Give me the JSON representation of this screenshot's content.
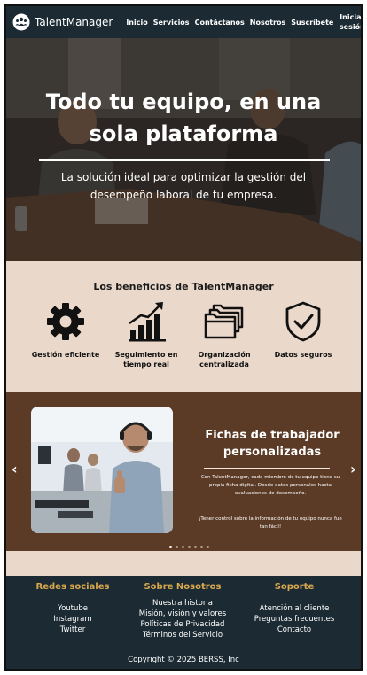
{
  "nav": {
    "brand": "TalentManager",
    "links": [
      "Inicio",
      "Servicios",
      "Contáctanos",
      "Nosotros",
      "Suscríbete"
    ],
    "login": "Iniciar sesión"
  },
  "hero": {
    "title": "Todo tu equipo, en una sola plataforma",
    "subtitle": "La solución ideal para optimizar la gestión del desempeño laboral de tu empresa."
  },
  "benefits": {
    "title": "Los beneficios de TalentManager",
    "items": [
      {
        "label": "Gestión eficiente",
        "icon": "gear-icon"
      },
      {
        "label": "Seguimiento en tiempo real",
        "icon": "growth-chart-icon"
      },
      {
        "label": "Organización centralizada",
        "icon": "folders-icon"
      },
      {
        "label": "Datos seguros",
        "icon": "shield-check-icon"
      }
    ]
  },
  "carousel": {
    "title": "Fichas de trabajador personalizadas",
    "text": "Con TalentManager, cada miembro de tu equipo tiene su propia ficha digital. Desde datos personales hasta evaluaciones de desempeño.",
    "text2": "¡Tener control sobre la información de tu equipo nunca fue tan fácil!",
    "prev": "‹",
    "next": "›",
    "active_slide": 1,
    "slide_count": 7
  },
  "footer": {
    "social": {
      "title": "Redes sociales",
      "items": [
        "Youtube",
        "Instagram",
        "Twitter"
      ]
    },
    "about": {
      "title": "Sobre Nosotros",
      "items": [
        "Nuestra historia",
        "Misión, visión y valores",
        "Políticas de Privacidad",
        "Términos del Servicio"
      ]
    },
    "support": {
      "title": "Soporte",
      "items": [
        "Atención al cliente",
        "Preguntas frecuentes",
        "Contacto"
      ]
    },
    "copyright": "Copyright © 2025 BERSS, Inc"
  },
  "colors": {
    "navbar": "#1c2b33",
    "beige": "#ead9cb",
    "brown": "#5c3b26",
    "footer_heading": "#d9a84e"
  }
}
